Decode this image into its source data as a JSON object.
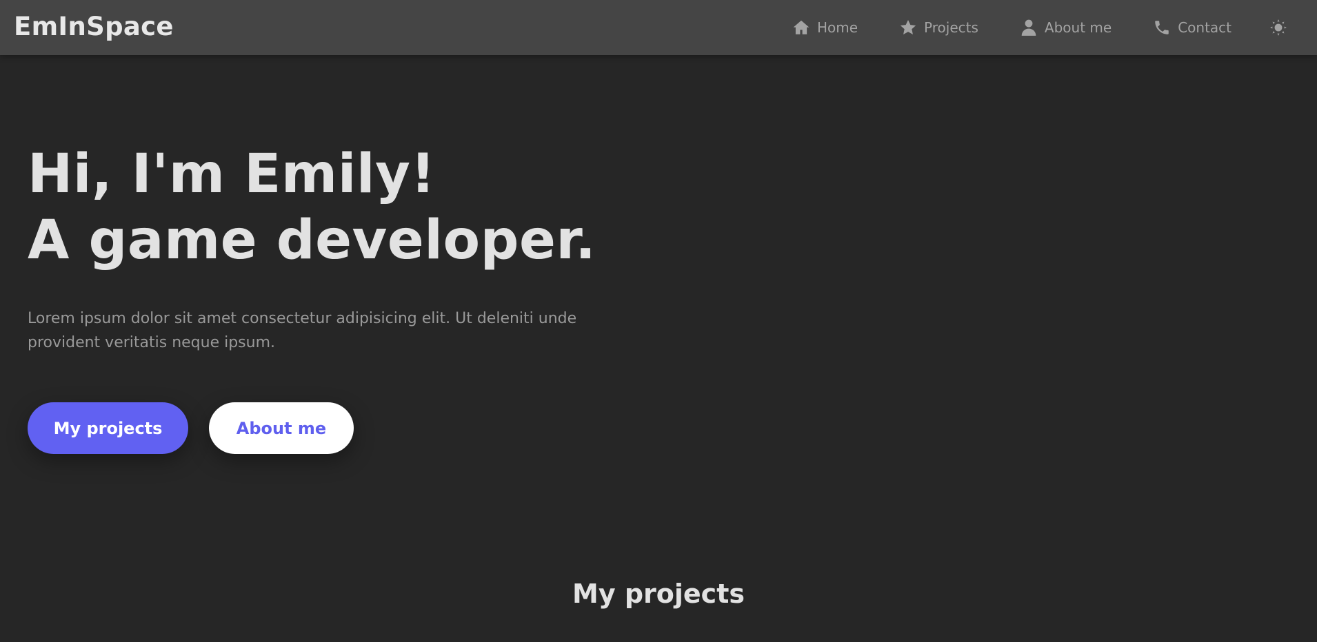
{
  "navbar": {
    "brand": "EmInSpace",
    "items": [
      {
        "label": "Home",
        "icon": "home-icon"
      },
      {
        "label": "Projects",
        "icon": "star-icon"
      },
      {
        "label": "About me",
        "icon": "user-icon"
      },
      {
        "label": "Contact",
        "icon": "phone-icon"
      }
    ],
    "theme_toggle_icon": "sun-icon"
  },
  "hero": {
    "title_line1": "Hi, I'm Emily!",
    "title_line2": "A game developer.",
    "description": "Lorem ipsum dolor sit amet consectetur adipisicing elit. Ut deleniti unde provident veritatis neque ipsum.",
    "primary_button": "My projects",
    "secondary_button": "About me"
  },
  "projects_section": {
    "title": "My projects"
  },
  "colors": {
    "background": "#262626",
    "navbar": "#454545",
    "accent": "#6161f2",
    "text": "#e2e2e2",
    "muted_text": "#999999"
  }
}
